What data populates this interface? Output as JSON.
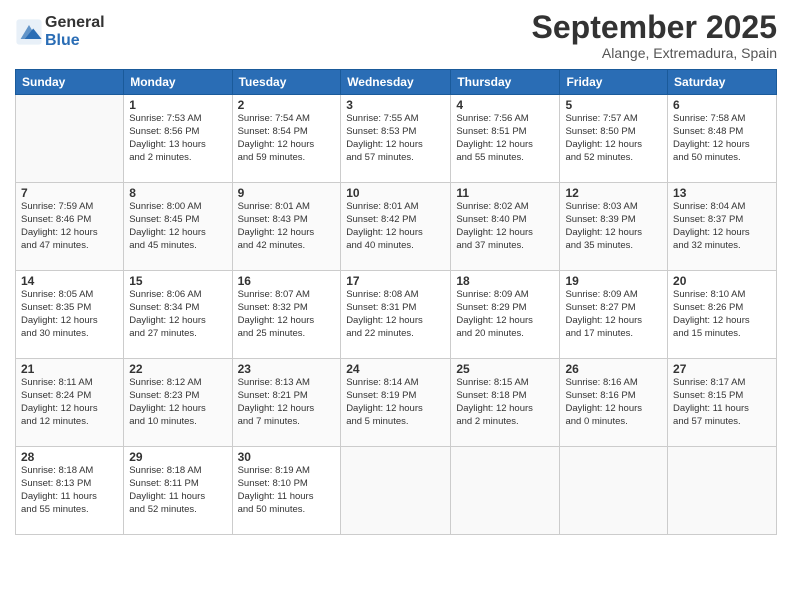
{
  "logo": {
    "general": "General",
    "blue": "Blue"
  },
  "title": "September 2025",
  "location": "Alange, Extremadura, Spain",
  "headers": [
    "Sunday",
    "Monday",
    "Tuesday",
    "Wednesday",
    "Thursday",
    "Friday",
    "Saturday"
  ],
  "weeks": [
    [
      {
        "day": "",
        "info": ""
      },
      {
        "day": "1",
        "info": "Sunrise: 7:53 AM\nSunset: 8:56 PM\nDaylight: 13 hours\nand 2 minutes."
      },
      {
        "day": "2",
        "info": "Sunrise: 7:54 AM\nSunset: 8:54 PM\nDaylight: 12 hours\nand 59 minutes."
      },
      {
        "day": "3",
        "info": "Sunrise: 7:55 AM\nSunset: 8:53 PM\nDaylight: 12 hours\nand 57 minutes."
      },
      {
        "day": "4",
        "info": "Sunrise: 7:56 AM\nSunset: 8:51 PM\nDaylight: 12 hours\nand 55 minutes."
      },
      {
        "day": "5",
        "info": "Sunrise: 7:57 AM\nSunset: 8:50 PM\nDaylight: 12 hours\nand 52 minutes."
      },
      {
        "day": "6",
        "info": "Sunrise: 7:58 AM\nSunset: 8:48 PM\nDaylight: 12 hours\nand 50 minutes."
      }
    ],
    [
      {
        "day": "7",
        "info": "Sunrise: 7:59 AM\nSunset: 8:46 PM\nDaylight: 12 hours\nand 47 minutes."
      },
      {
        "day": "8",
        "info": "Sunrise: 8:00 AM\nSunset: 8:45 PM\nDaylight: 12 hours\nand 45 minutes."
      },
      {
        "day": "9",
        "info": "Sunrise: 8:01 AM\nSunset: 8:43 PM\nDaylight: 12 hours\nand 42 minutes."
      },
      {
        "day": "10",
        "info": "Sunrise: 8:01 AM\nSunset: 8:42 PM\nDaylight: 12 hours\nand 40 minutes."
      },
      {
        "day": "11",
        "info": "Sunrise: 8:02 AM\nSunset: 8:40 PM\nDaylight: 12 hours\nand 37 minutes."
      },
      {
        "day": "12",
        "info": "Sunrise: 8:03 AM\nSunset: 8:39 PM\nDaylight: 12 hours\nand 35 minutes."
      },
      {
        "day": "13",
        "info": "Sunrise: 8:04 AM\nSunset: 8:37 PM\nDaylight: 12 hours\nand 32 minutes."
      }
    ],
    [
      {
        "day": "14",
        "info": "Sunrise: 8:05 AM\nSunset: 8:35 PM\nDaylight: 12 hours\nand 30 minutes."
      },
      {
        "day": "15",
        "info": "Sunrise: 8:06 AM\nSunset: 8:34 PM\nDaylight: 12 hours\nand 27 minutes."
      },
      {
        "day": "16",
        "info": "Sunrise: 8:07 AM\nSunset: 8:32 PM\nDaylight: 12 hours\nand 25 minutes."
      },
      {
        "day": "17",
        "info": "Sunrise: 8:08 AM\nSunset: 8:31 PM\nDaylight: 12 hours\nand 22 minutes."
      },
      {
        "day": "18",
        "info": "Sunrise: 8:09 AM\nSunset: 8:29 PM\nDaylight: 12 hours\nand 20 minutes."
      },
      {
        "day": "19",
        "info": "Sunrise: 8:09 AM\nSunset: 8:27 PM\nDaylight: 12 hours\nand 17 minutes."
      },
      {
        "day": "20",
        "info": "Sunrise: 8:10 AM\nSunset: 8:26 PM\nDaylight: 12 hours\nand 15 minutes."
      }
    ],
    [
      {
        "day": "21",
        "info": "Sunrise: 8:11 AM\nSunset: 8:24 PM\nDaylight: 12 hours\nand 12 minutes."
      },
      {
        "day": "22",
        "info": "Sunrise: 8:12 AM\nSunset: 8:23 PM\nDaylight: 12 hours\nand 10 minutes."
      },
      {
        "day": "23",
        "info": "Sunrise: 8:13 AM\nSunset: 8:21 PM\nDaylight: 12 hours\nand 7 minutes."
      },
      {
        "day": "24",
        "info": "Sunrise: 8:14 AM\nSunset: 8:19 PM\nDaylight: 12 hours\nand 5 minutes."
      },
      {
        "day": "25",
        "info": "Sunrise: 8:15 AM\nSunset: 8:18 PM\nDaylight: 12 hours\nand 2 minutes."
      },
      {
        "day": "26",
        "info": "Sunrise: 8:16 AM\nSunset: 8:16 PM\nDaylight: 12 hours\nand 0 minutes."
      },
      {
        "day": "27",
        "info": "Sunrise: 8:17 AM\nSunset: 8:15 PM\nDaylight: 11 hours\nand 57 minutes."
      }
    ],
    [
      {
        "day": "28",
        "info": "Sunrise: 8:18 AM\nSunset: 8:13 PM\nDaylight: 11 hours\nand 55 minutes."
      },
      {
        "day": "29",
        "info": "Sunrise: 8:18 AM\nSunset: 8:11 PM\nDaylight: 11 hours\nand 52 minutes."
      },
      {
        "day": "30",
        "info": "Sunrise: 8:19 AM\nSunset: 8:10 PM\nDaylight: 11 hours\nand 50 minutes."
      },
      {
        "day": "",
        "info": ""
      },
      {
        "day": "",
        "info": ""
      },
      {
        "day": "",
        "info": ""
      },
      {
        "day": "",
        "info": ""
      }
    ]
  ]
}
